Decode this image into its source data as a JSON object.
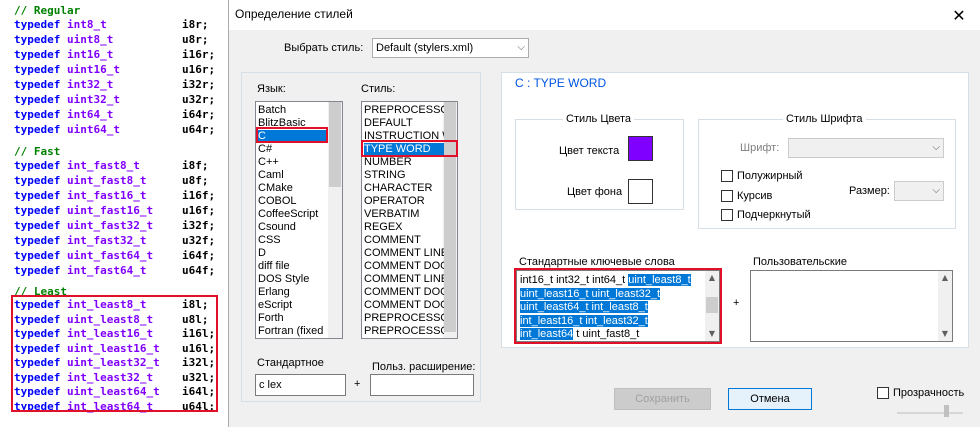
{
  "editor": {
    "comment_regular": "// Regular",
    "comment_fast": "// Fast",
    "comment_least": "// Least",
    "keyword": "typedef",
    "regular": [
      {
        "type": "int8_t",
        "name": "i8r;"
      },
      {
        "type": "uint8_t",
        "name": "u8r;"
      },
      {
        "type": "int16_t",
        "name": "i16r;"
      },
      {
        "type": "uint16_t",
        "name": "u16r;"
      },
      {
        "type": "int32_t",
        "name": "i32r;"
      },
      {
        "type": "uint32_t",
        "name": "u32r;"
      },
      {
        "type": "int64_t",
        "name": "i64r;"
      },
      {
        "type": "uint64_t",
        "name": "u64r;"
      }
    ],
    "fast": [
      {
        "type": "int_fast8_t",
        "name": "i8f;"
      },
      {
        "type": "uint_fast8_t",
        "name": "u8f;"
      },
      {
        "type": "int_fast16_t",
        "name": "i16f;"
      },
      {
        "type": "uint_fast16_t",
        "name": "u16f;"
      },
      {
        "type": "uint_fast32_t",
        "name": "i32f;"
      },
      {
        "type": "int_fast32_t",
        "name": "u32f;"
      },
      {
        "type": "uint_fast64_t",
        "name": "i64f;"
      },
      {
        "type": "int_fast64_t",
        "name": "u64f;"
      }
    ],
    "least": [
      {
        "type": "int_least8_t",
        "name": "i8l;"
      },
      {
        "type": "uint_least8_t",
        "name": "u8l;"
      },
      {
        "type": "int_least16_t",
        "name": "i16l;"
      },
      {
        "type": "uint_least16_t",
        "name": "u16l;"
      },
      {
        "type": "uint_least32_t",
        "name": "i32l;"
      },
      {
        "type": "int_least32_t",
        "name": "u32l;"
      },
      {
        "type": "uint_least64_t",
        "name": "i64l;"
      },
      {
        "type": "int_least64_t",
        "name": "u64l;"
      }
    ]
  },
  "dialog": {
    "title": "Определение стилей",
    "close_glyph": "✕",
    "select_style_label": "Выбрать стиль:",
    "select_style_value": "Default (stylers.xml)",
    "language_label": "Язык:",
    "style_label": "Стиль:",
    "languages": [
      "Batch",
      "BlitzBasic",
      "C",
      "C#",
      "C++",
      "Caml",
      "CMake",
      "COBOL",
      "CoffeeScript",
      "Csound",
      "CSS",
      "D",
      "diff file",
      "DOS Style",
      "Erlang",
      "eScript",
      "Forth",
      "Fortran (fixed"
    ],
    "selected_language": "C",
    "styles": [
      "PREPROCESSOR",
      "DEFAULT",
      "INSTRUCTION WO",
      "TYPE WORD",
      "NUMBER",
      "STRING",
      "CHARACTER",
      "OPERATOR",
      "VERBATIM",
      "REGEX",
      "COMMENT",
      "COMMENT LINE",
      "COMMENT DOC",
      "COMMENT LINE DO",
      "COMMENT DOC KE",
      "COMMENT DOC KE",
      "PREPROCESSOR C",
      "PREPROCESSOR C"
    ],
    "selected_style": "TYPE WORD",
    "default_ext_label": "Стандартное",
    "default_ext_value": "c lex",
    "user_ext_label": "Польз. расширение:",
    "user_ext_value": "",
    "plus": "+",
    "section_title": "C : TYPE WORD",
    "color_group_title": "Стиль Цвета",
    "fg_label": "Цвет текста",
    "bg_label": "Цвет фона",
    "fg_color": "#8000ff",
    "bg_color": "#ffffff",
    "font_group_title": "Стиль Шрифта",
    "font_label": "Шрифт:",
    "bold_label": "Полужирный",
    "italic_label": "Курсив",
    "underline_label": "Подчеркнутый",
    "size_label": "Размер:",
    "keywords_label": "Стандартные ключевые слова",
    "user_keywords_label": "Пользовательские",
    "keywords_lines": [
      {
        "plain": "int16_t int32_t int64_t ",
        "sel": "uint_least8_t"
      },
      {
        "plain": "",
        "sel": "uint_least16_t uint_least32_t"
      },
      {
        "plain": "",
        "sel": "uint_least64_t int_least8_t"
      },
      {
        "plain": "",
        "sel": "int_least16_t int_least32_t"
      },
      {
        "plain": " t uint_fast8_t",
        "sel": "int_least64"
      }
    ],
    "save_label": "Сохранить",
    "cancel_label": "Отмена",
    "transparency_label": "Прозрачность"
  }
}
